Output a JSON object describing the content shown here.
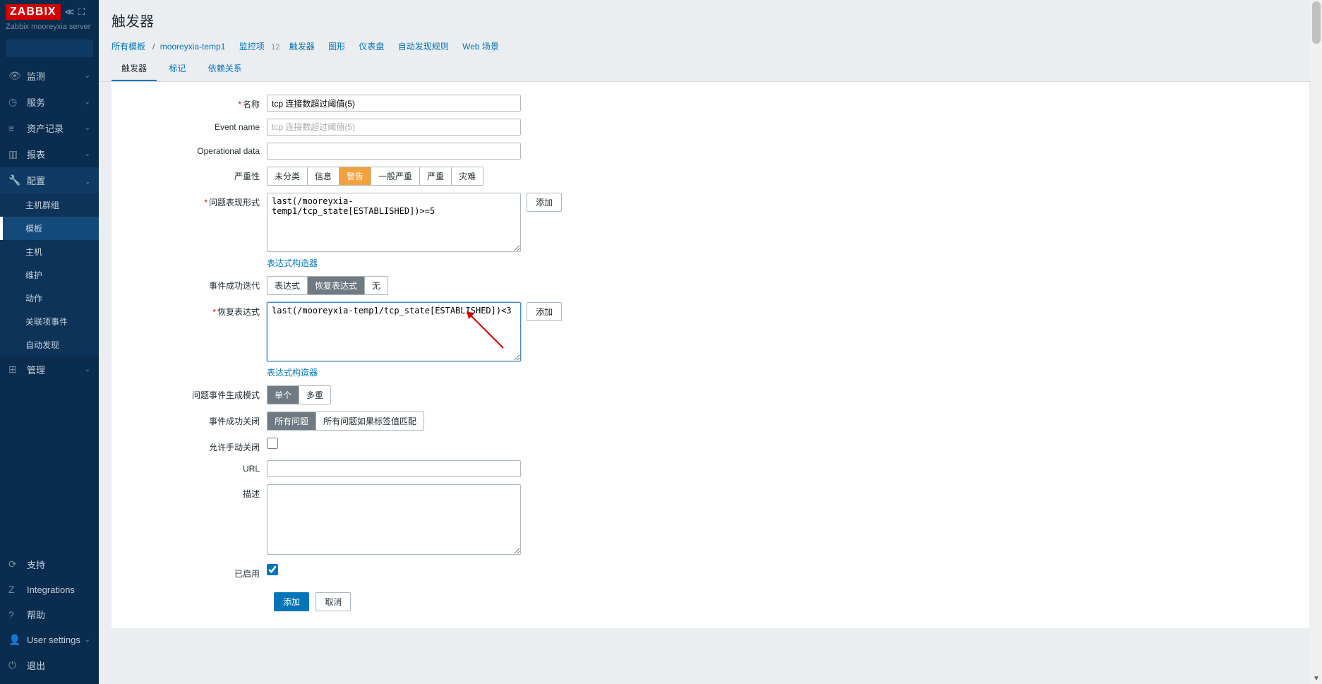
{
  "brand": {
    "logo": "ZABBIX",
    "server": "Zabbix mooreyxia server"
  },
  "search": {
    "placeholder": ""
  },
  "nav": {
    "main": [
      {
        "icon": "◉",
        "label": "监测"
      },
      {
        "icon": "⊙",
        "label": "服务"
      },
      {
        "icon": "≣",
        "label": "资产记录"
      },
      {
        "icon": "▣",
        "label": "报表"
      },
      {
        "icon": "🔧",
        "label": "配置",
        "expanded": true,
        "sub": [
          {
            "label": "主机群组"
          },
          {
            "label": "模板",
            "selected": true
          },
          {
            "label": "主机"
          },
          {
            "label": "维护"
          },
          {
            "label": "动作"
          },
          {
            "label": "关联项事件"
          },
          {
            "label": "自动发现"
          }
        ]
      },
      {
        "icon": "⊞",
        "label": "管理"
      }
    ],
    "bottom": [
      {
        "icon": "⟳",
        "label": "支持"
      },
      {
        "icon": "Z",
        "label": "Integrations"
      },
      {
        "icon": "?",
        "label": "帮助"
      },
      {
        "icon": "👤",
        "label": "User settings"
      },
      {
        "icon": "⏻",
        "label": "退出"
      }
    ]
  },
  "page": {
    "title": "触发器"
  },
  "breadcrumb": {
    "all_templates": "所有模板",
    "template_name": "mooreyxia-temp1",
    "links": [
      {
        "label": "监控项",
        "count": "12"
      },
      {
        "label": "触发器"
      },
      {
        "label": "图形"
      },
      {
        "label": "仪表盘"
      },
      {
        "label": "自动发现规则"
      },
      {
        "label": "Web 场景"
      }
    ]
  },
  "tabs": [
    {
      "label": "触发器",
      "active": true
    },
    {
      "label": "标记"
    },
    {
      "label": "依赖关系"
    }
  ],
  "form": {
    "name_label": "名称",
    "name_value": "tcp 连接数超过阈值(5)",
    "event_name_label": "Event name",
    "event_name_placeholder": "tcp 连接数超过阈值(5)",
    "opdata_label": "Operational data",
    "severity_label": "严重性",
    "severity_options": [
      "未分类",
      "信息",
      "警告",
      "一般严重",
      "严重",
      "灾难"
    ],
    "problem_expr_label": "问题表现形式",
    "problem_expr_value": "last(/mooreyxia-temp1/tcp_state[ESTABLISHED])>=5",
    "add_btn": "添加",
    "expr_constructor": "表达式构造器",
    "event_ok_label": "事件成功迭代",
    "event_ok_options": [
      "表达式",
      "恢复表达式",
      "无"
    ],
    "recovery_expr_label": "恢复表达式",
    "recovery_expr_value": "last(/mooreyxia-temp1/tcp_state[ESTABLISHED])<3",
    "problem_mode_label": "问题事件生成模式",
    "problem_mode_options": [
      "单个",
      "多重"
    ],
    "ok_close_label": "事件成功关闭",
    "ok_close_options": [
      "所有问题",
      "所有问题如果标签值匹配"
    ],
    "manual_close_label": "允许手动关闭",
    "url_label": "URL",
    "desc_label": "描述",
    "enabled_label": "已启用",
    "submit": "添加",
    "cancel": "取消"
  }
}
